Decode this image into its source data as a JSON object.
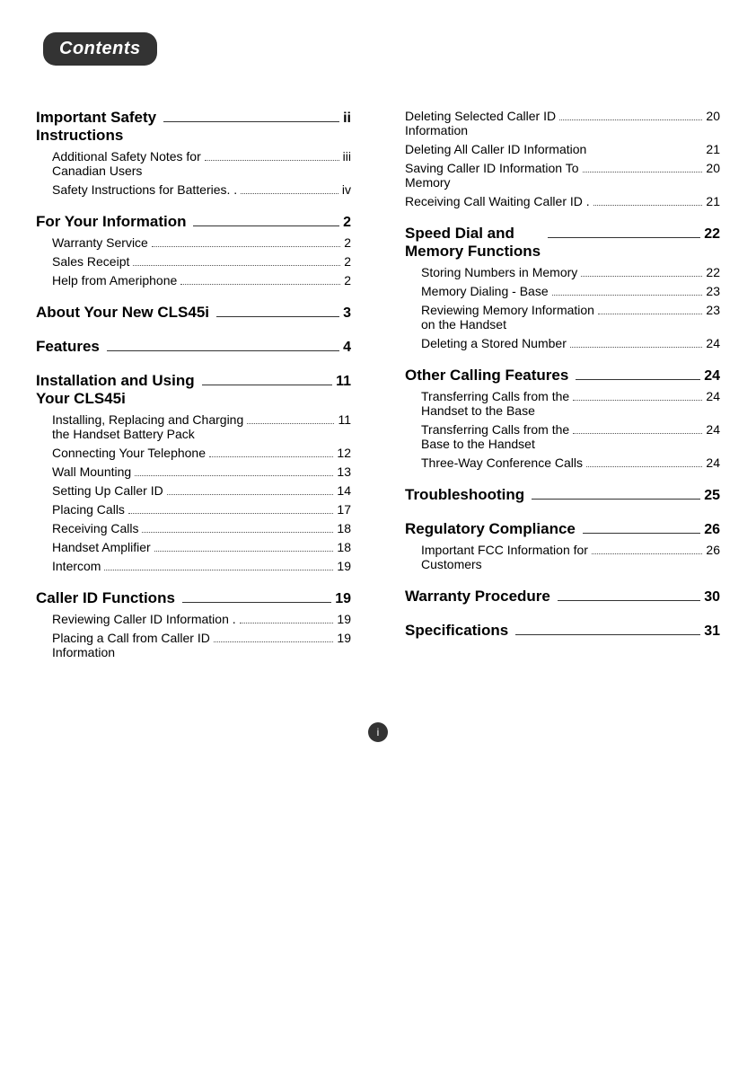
{
  "header": {
    "title": "Contents"
  },
  "left_column": {
    "sections": [
      {
        "id": "important-safety",
        "title": "Important Safety Instructions",
        "has_line": true,
        "page": "ii",
        "sub_entries": [
          {
            "label": "Additional Safety Notes for Canadian Users",
            "dots": true,
            "page": "iii"
          },
          {
            "label": "Safety Instructions for Batteries. .",
            "dots": false,
            "page": "iv"
          }
        ]
      },
      {
        "id": "for-your-information",
        "title": "For Your Information",
        "has_line": true,
        "page": "2",
        "sub_entries": [
          {
            "label": "Warranty Service",
            "dots": true,
            "page": "2"
          },
          {
            "label": "Sales Receipt",
            "dots": true,
            "page": "2"
          },
          {
            "label": "Help from Ameriphone",
            "dots": true,
            "page": "2"
          }
        ]
      },
      {
        "id": "about-your-new",
        "title": "About Your New CLS45i",
        "has_line": true,
        "page": "3",
        "sub_entries": []
      },
      {
        "id": "features",
        "title": "Features",
        "has_line": true,
        "page": "4",
        "sub_entries": []
      },
      {
        "id": "installation",
        "title": "Installation and Using Your CLS45i",
        "has_line": true,
        "page": "11",
        "sub_entries": [
          {
            "label": "Installing, Replacing and Charging the Handset Battery Pack",
            "dots": true,
            "page": "11"
          },
          {
            "label": "Connecting Your Telephone",
            "dots": true,
            "page": "12"
          },
          {
            "label": "Wall Mounting",
            "dots": true,
            "page": "13"
          },
          {
            "label": "Setting Up Caller ID",
            "dots": true,
            "page": "14"
          },
          {
            "label": "Placing Calls",
            "dots": true,
            "page": "17"
          },
          {
            "label": "Receiving Calls",
            "dots": true,
            "page": "18"
          },
          {
            "label": "Handset Amplifier",
            "dots": true,
            "page": "18"
          },
          {
            "label": "Intercom",
            "dots": true,
            "page": "19"
          }
        ]
      },
      {
        "id": "caller-id",
        "title": "Caller ID Functions",
        "has_line": true,
        "page": "19",
        "sub_entries": [
          {
            "label": "Reviewing Caller ID Information .",
            "dots": false,
            "page": "19"
          },
          {
            "label": "Placing a Call from Caller ID Information",
            "dots": true,
            "page": "19"
          }
        ]
      }
    ]
  },
  "right_column": {
    "sections": [
      {
        "id": "deleting-selected",
        "title": null,
        "sub_entries": [
          {
            "label": "Deleting Selected Caller ID Information",
            "dots": true,
            "page": "20"
          },
          {
            "label": "Deleting All Caller ID Information",
            "dots": false,
            "page": "21"
          },
          {
            "label": "Saving Caller ID Information To Memory",
            "dots": true,
            "page": "20"
          },
          {
            "label": "Receiving Call Waiting Caller ID .",
            "dots": false,
            "page": "21"
          }
        ]
      },
      {
        "id": "speed-dial",
        "title": "Speed Dial and Memory Functions",
        "has_line": true,
        "page": "22",
        "sub_entries": [
          {
            "label": "Storing Numbers in Memory",
            "dots": true,
            "page": "22"
          },
          {
            "label": "Memory Dialing - Base",
            "dots": true,
            "page": "23"
          },
          {
            "label": "Reviewing Memory Information on the Handset",
            "dots": true,
            "page": "23"
          },
          {
            "label": "Deleting a Stored Number",
            "dots": true,
            "page": "24"
          }
        ]
      },
      {
        "id": "other-calling",
        "title": "Other Calling Features",
        "has_line": true,
        "page": "24",
        "sub_entries": [
          {
            "label": "Transferring Calls from the Handset to the Base",
            "dots": true,
            "page": "24"
          },
          {
            "label": "Transferring Calls from the Base to the Handset",
            "dots": true,
            "page": "24"
          },
          {
            "label": "Three-Way Conference Calls",
            "dots": true,
            "page": "24"
          }
        ]
      },
      {
        "id": "troubleshooting",
        "title": "Troubleshooting",
        "has_line": true,
        "page": "25",
        "sub_entries": []
      },
      {
        "id": "regulatory",
        "title": "Regulatory Compliance",
        "has_line": true,
        "page": "26",
        "sub_entries": [
          {
            "label": "Important FCC Information for Customers",
            "dots": true,
            "page": "26"
          }
        ]
      },
      {
        "id": "warranty",
        "title": "Warranty Procedure",
        "has_line": true,
        "page": "30",
        "sub_entries": []
      },
      {
        "id": "specifications",
        "title": "Specifications",
        "has_line": true,
        "page": "31",
        "sub_entries": []
      }
    ]
  },
  "footer": {
    "page_number": "i"
  }
}
